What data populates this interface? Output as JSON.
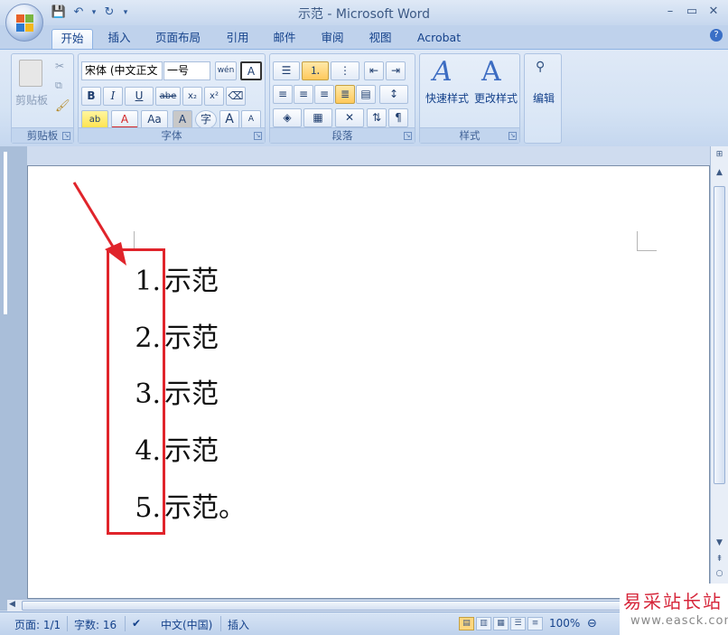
{
  "window": {
    "title": "示范 - Microsoft Word",
    "minimize": "–",
    "maximize": "▭",
    "close": "✕"
  },
  "qat": {
    "save": "💾",
    "undo": "↶",
    "undo_menu": "▾",
    "redo": "↻",
    "customize": "▾"
  },
  "tabs": [
    "开始",
    "插入",
    "页面布局",
    "引用",
    "邮件",
    "审阅",
    "视图",
    "Acrobat"
  ],
  "help": "?",
  "ribbon": {
    "clipboard": {
      "name": "剪贴板",
      "paste": "粘贴"
    },
    "font": {
      "name": "字体",
      "font_name": "宋体 (中文正文",
      "font_size": "一号",
      "phonetic": "wén",
      "border_char": "A",
      "bold": "B",
      "italic": "I",
      "underline": "U",
      "strike": "abe",
      "subscript": "x₂",
      "superscript": "x²",
      "highlight": "ab",
      "font_color": "A",
      "change_case": "Aa",
      "shade": "A",
      "enclose": "字",
      "grow": "A",
      "shrink": "A"
    },
    "paragraph": {
      "name": "段落"
    },
    "styles": {
      "name": "样式",
      "quick": "快速样式",
      "change": "更改样式"
    },
    "editing": {
      "name": "编辑"
    }
  },
  "document": {
    "list": [
      {
        "num": "1.",
        "text": "示范"
      },
      {
        "num": "2.",
        "text": "示范"
      },
      {
        "num": "3.",
        "text": "示范"
      },
      {
        "num": "4.",
        "text": "示范"
      },
      {
        "num": "5.",
        "text": "示范。"
      }
    ]
  },
  "status": {
    "page": "页面: 1/1",
    "words": "字数: 16",
    "language": "中文(中国)",
    "mode": "插入",
    "zoom": "100%"
  },
  "watermark": {
    "brand": "易采站长站",
    "url": "www.easck.com"
  },
  "colors": {
    "annotation_red": "#e0242b"
  }
}
